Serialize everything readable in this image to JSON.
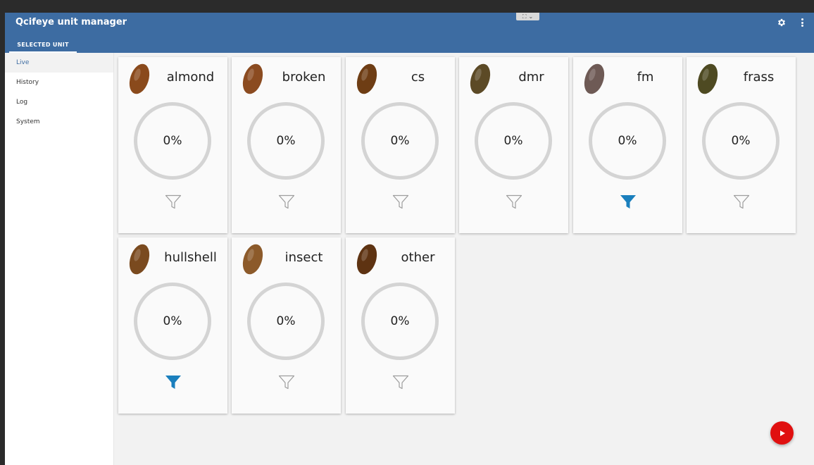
{
  "app": {
    "title": "Qcifeye unit manager"
  },
  "tabs": {
    "selected_unit": "SELECTED UNIT"
  },
  "sidebar": {
    "items": [
      {
        "label": "Live"
      },
      {
        "label": "History"
      },
      {
        "label": "Log"
      },
      {
        "label": "System"
      }
    ]
  },
  "categories": [
    {
      "label": "almond",
      "value": "0%",
      "filter_active": false,
      "thumb_color": "#8a4a1c"
    },
    {
      "label": "broken",
      "value": "0%",
      "filter_active": false,
      "thumb_color": "#8b4b20"
    },
    {
      "label": "cs",
      "value": "0%",
      "filter_active": false,
      "thumb_color": "#6e3d14"
    },
    {
      "label": "dmr",
      "value": "0%",
      "filter_active": false,
      "thumb_color": "#5c4a26"
    },
    {
      "label": "fm",
      "value": "0%",
      "filter_active": true,
      "thumb_color": "#6e5a55"
    },
    {
      "label": "frass",
      "value": "0%",
      "filter_active": false,
      "thumb_color": "#4e4a22"
    },
    {
      "label": "hullshell",
      "value": "0%",
      "filter_active": true,
      "thumb_color": "#7a4a1f"
    },
    {
      "label": "insect",
      "value": "0%",
      "filter_active": false,
      "thumb_color": "#8c5a2a"
    },
    {
      "label": "other",
      "value": "0%",
      "filter_active": false,
      "thumb_color": "#5e3312"
    }
  ],
  "colors": {
    "appbar": "#3d6ca2",
    "filter_active": "#1a7fbd",
    "filter_inactive": "#9e9e9e",
    "play_button": "#e01010"
  },
  "icons": {
    "settings": "gear-icon",
    "menu": "more-vert-icon",
    "filter": "filter-icon",
    "play": "play-icon"
  }
}
